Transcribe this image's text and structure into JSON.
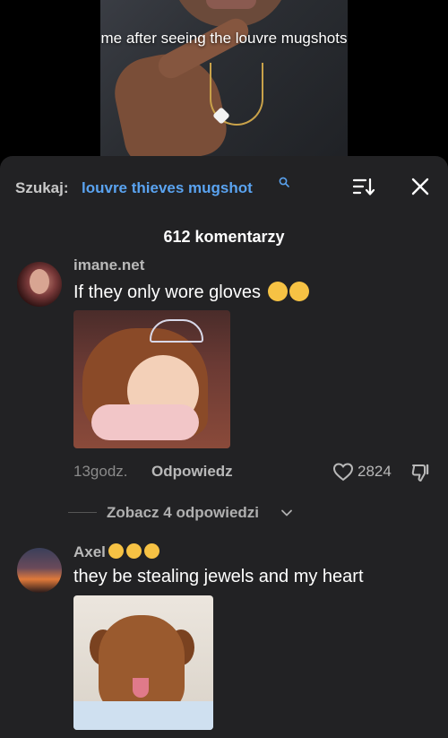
{
  "video": {
    "caption": "me after seeing the louvre mugshots"
  },
  "comments_panel": {
    "search_prefix": "Szukaj:",
    "search_query": "louvre thieves mugshot",
    "count_label": "612 komentarzy"
  },
  "comments": [
    {
      "username": "imane.net",
      "text": "If they only wore gloves",
      "emojis": [
        "pensive-face",
        "pensive-face"
      ],
      "time": "13godz.",
      "reply_label": "Odpowiedz",
      "likes": "2824",
      "view_replies_label": "Zobacz 4 odpowiedzi"
    },
    {
      "username": "Axel",
      "username_emojis": [
        "smirking-cat",
        "heart-eyes-cat",
        "smirking-cat"
      ],
      "text": "they be stealing jewels and my heart"
    }
  ],
  "colors": {
    "panel_bg": "#222224",
    "search_query": "#5aa3f0",
    "muted_text": "#b9b9b9"
  }
}
